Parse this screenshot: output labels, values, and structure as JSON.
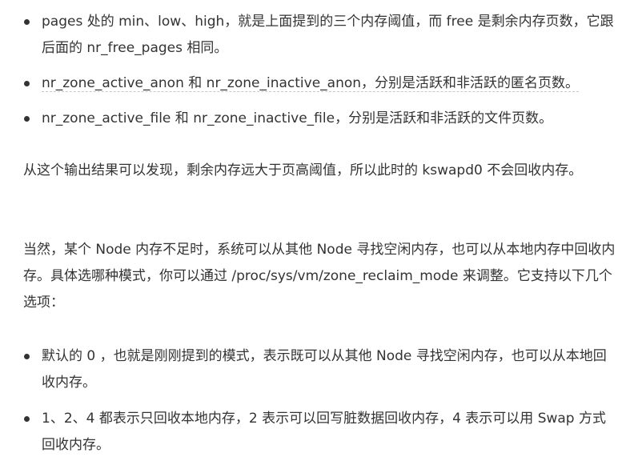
{
  "list1": [
    "pages 处的 min、low、high，就是上面提到的三个内存阈值，而 free 是剩余内存页数，它跟后面的 nr_free_pages 相同。",
    "nr_zone_active_anon 和 nr_zone_inactive_anon，分别是活跃和非活跃的匿名页数。",
    "nr_zone_active_file 和 nr_zone_inactive_file，分别是活跃和非活跃的文件页数。"
  ],
  "para1": "从这个输出结果可以发现，剩余内存远大于页高阈值，所以此时的 kswapd0 不会回收内存。",
  "para2": "当然，某个 Node 内存不足时，系统可以从其他 Node 寻找空闲内存，也可以从本地内存中回收内存。具体选哪种模式，你可以通过 /proc/sys/vm/zone_reclaim_mode 来调整。它支持以下几个选项：",
  "list2": [
    "默认的 0 ，也就是刚刚提到的模式，表示既可以从其他 Node 寻找空闲内存，也可以从本地回收内存。",
    "1、2、4 都表示只回收本地内存，2 表示可以回写脏数据回收内存，4 表示可以用 Swap 方式回收内存。"
  ]
}
